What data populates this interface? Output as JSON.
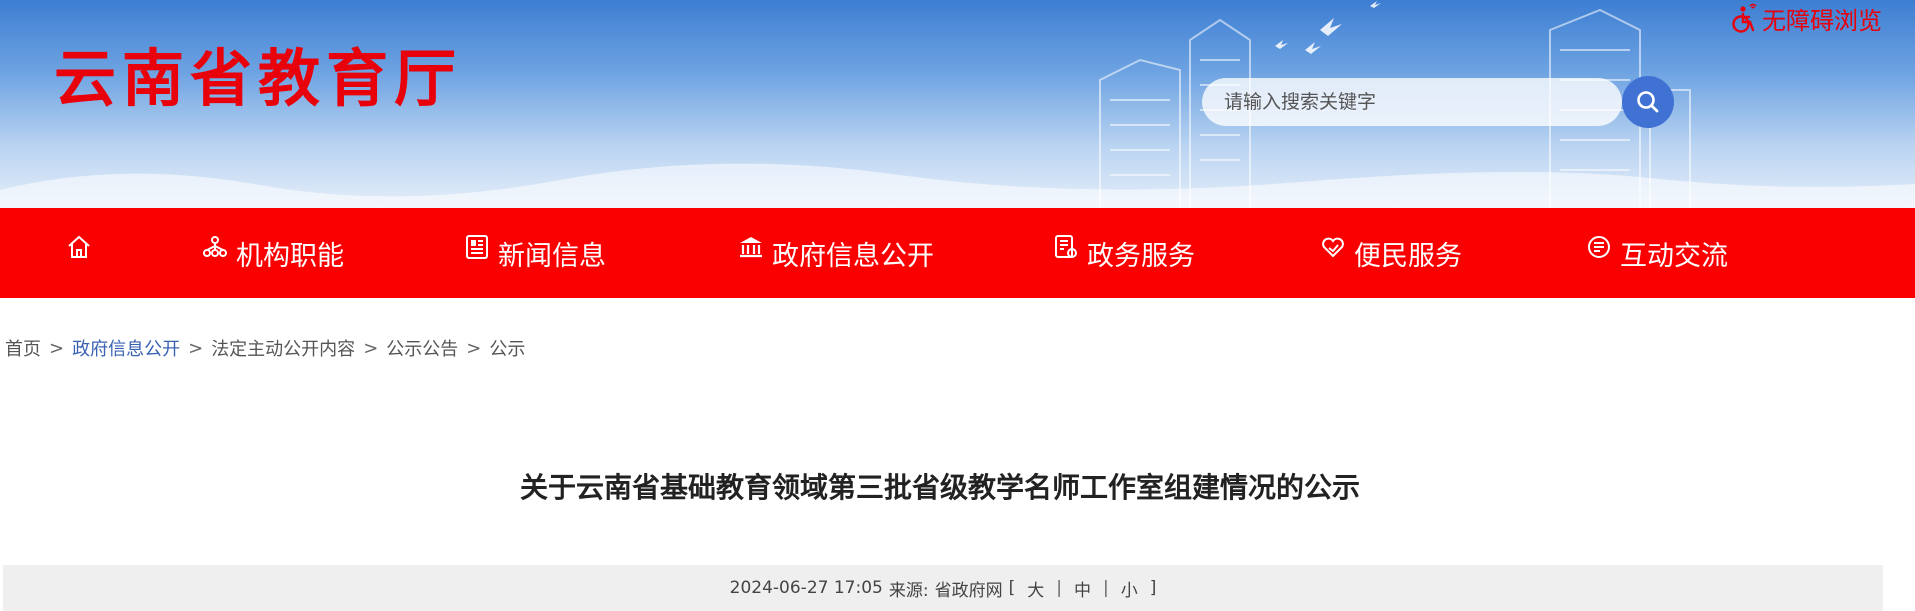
{
  "header": {
    "site_name": "云南省教育厅",
    "accessibility_label": "无障碍浏览",
    "search": {
      "placeholder": "请输入搜索关键字"
    }
  },
  "nav": {
    "items": [
      {
        "label": "",
        "icon": "home-icon"
      },
      {
        "label": "机构职能",
        "icon": "org-chart-icon"
      },
      {
        "label": "新闻信息",
        "icon": "news-icon"
      },
      {
        "label": "政府信息公开",
        "icon": "government-building-icon"
      },
      {
        "label": "政务服务",
        "icon": "service-document-icon"
      },
      {
        "label": "便民服务",
        "icon": "heart-hand-icon"
      },
      {
        "label": "互动交流",
        "icon": "interaction-icon"
      }
    ]
  },
  "breadcrumb": {
    "items": [
      "首页",
      "政府信息公开",
      "法定主动公开内容",
      "公示公告",
      "公示"
    ],
    "separator": ">"
  },
  "article": {
    "title": "关于云南省基础教育领域第三批省级教学名师工作室组建情况的公示",
    "date": "2024-06-27 17:05",
    "source_label": "来源:",
    "source": "省政府网",
    "font_size_label_open": "[",
    "font_size_label_close": "]",
    "font_sizes": [
      "大",
      "中",
      "小"
    ]
  },
  "colors": {
    "brand_red": "#e8000b",
    "nav_red": "#fb0000",
    "search_blue": "#3f72d3",
    "link_blue": "#3a62b3"
  }
}
